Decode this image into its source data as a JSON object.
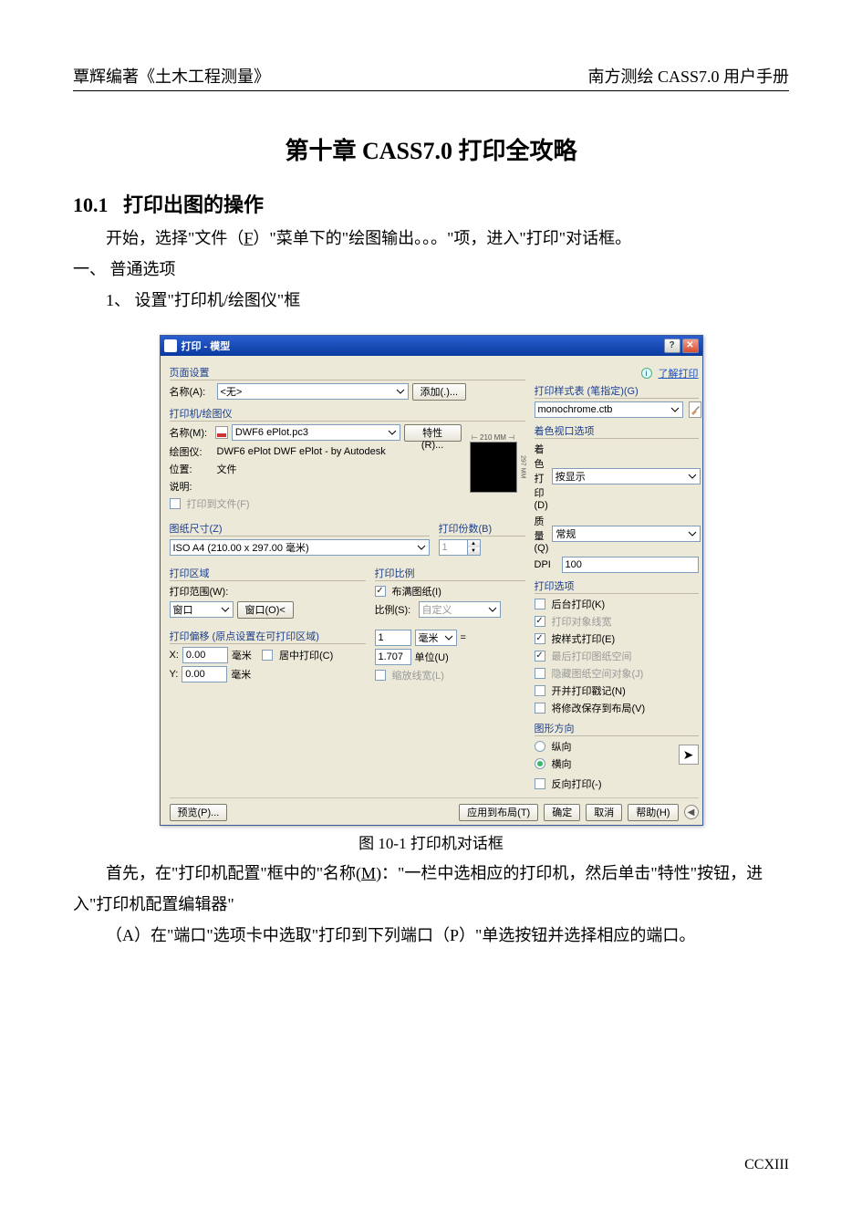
{
  "header": {
    "left": "覃辉编著《土木工程测量》",
    "right": "南方测绘 CASS7.0 用户手册"
  },
  "chapter_title": "第十章    CASS7.0 打印全攻略",
  "section": {
    "num": "10.1",
    "title": "打印出图的操作"
  },
  "para1_a": "开始，选择\"文件（",
  "para1_u": "F",
  "para1_b": "）\"菜单下的\"绘图输出。。。\"项，进入\"打印\"对话框。",
  "item1": "一、  普通选项",
  "item1_1": "1、 设置\"打印机/绘图仪\"框",
  "fig_caption": "图 10-1 打印机对话框",
  "para2_a": "首先，在\"打印机配置\"框中的\"名称(",
  "para2_u": "M",
  "para2_b": ")：\"一栏中选相应的打印机，然后单击\"特性\"按钮，进入\"打印机配置编辑器\"",
  "para3": "（A）在\"端口\"选项卡中选取\"打印到下列端口（P）\"单选按钮并选择相应的端口。",
  "page_number": "CCXIII",
  "dlg": {
    "title": "打印 - 模型",
    "learn_link": "了解打印",
    "page_setup": {
      "group": "页面设置",
      "name_lbl": "名称(A):",
      "name_val": "<无>",
      "add_btn": "添加(.)..."
    },
    "style_table": {
      "group": "打印样式表 (笔指定)(G)",
      "value": "monochrome.ctb"
    },
    "printer": {
      "group": "打印机/绘图仪",
      "name_lbl": "名称(M):",
      "name_val": "DWF6 ePlot.pc3",
      "props_btn": "特性(R)...",
      "plotter_lbl": "绘图仪:",
      "plotter_val": "DWF6 ePlot DWF ePlot - by Autodesk",
      "where_lbl": "位置:",
      "where_val": "文件",
      "desc_lbl": "说明:",
      "plot_to_file": "打印到文件(F)",
      "paper_top": "210 MM",
      "paper_side": "297 MM"
    },
    "shaded": {
      "group": "着色视口选项",
      "shade_lbl": "着色打印(D)",
      "shade_val": "按显示",
      "quality_lbl": "质量(Q)",
      "quality_val": "常规",
      "dpi_lbl": "DPI",
      "dpi_val": "100"
    },
    "paper_size": {
      "group": "图纸尺寸(Z)",
      "value": "ISO A4 (210.00 x 297.00 毫米)"
    },
    "copies": {
      "group": "打印份数(B)",
      "val": "1"
    },
    "options": {
      "group": "打印选项",
      "bg": "后台打印(K)",
      "lw": "打印对象线宽",
      "style": "按样式打印(E)",
      "paperspace_last": "最后打印图纸空间",
      "hide_ps": "隐藏图纸空间对象(J)",
      "stamp": "开并打印戳记(N)",
      "save_layout": "将修改保存到布局(V)"
    },
    "area": {
      "group": "打印区域",
      "what_lbl": "打印范围(W):",
      "what_val": "窗口",
      "window_btn": "窗口(O)<"
    },
    "scale": {
      "group": "打印比例",
      "fit": "布满图纸(I)",
      "ratio_lbl": "比例(S):",
      "ratio_val": "自定义",
      "unit_val": "1",
      "unit_lbl": "毫米",
      "equals": "=",
      "drawing_val": "1.707",
      "drawing_lbl": "单位(U)",
      "scale_lw": "缩放线宽(L)"
    },
    "offset": {
      "group": "打印偏移 (原点设置在可打印区域)",
      "x_lbl": "X:",
      "x_val": "0.00",
      "x_unit": "毫米",
      "center": "居中打印(C)",
      "y_lbl": "Y:",
      "y_val": "0.00",
      "y_unit": "毫米"
    },
    "orient": {
      "group": "图形方向",
      "portrait": "纵向",
      "landscape": "横向",
      "reverse": "反向打印(-)"
    },
    "footer": {
      "preview": "预览(P)...",
      "apply": "应用到布局(T)",
      "ok": "确定",
      "cancel": "取消",
      "help": "帮助(H)"
    }
  }
}
